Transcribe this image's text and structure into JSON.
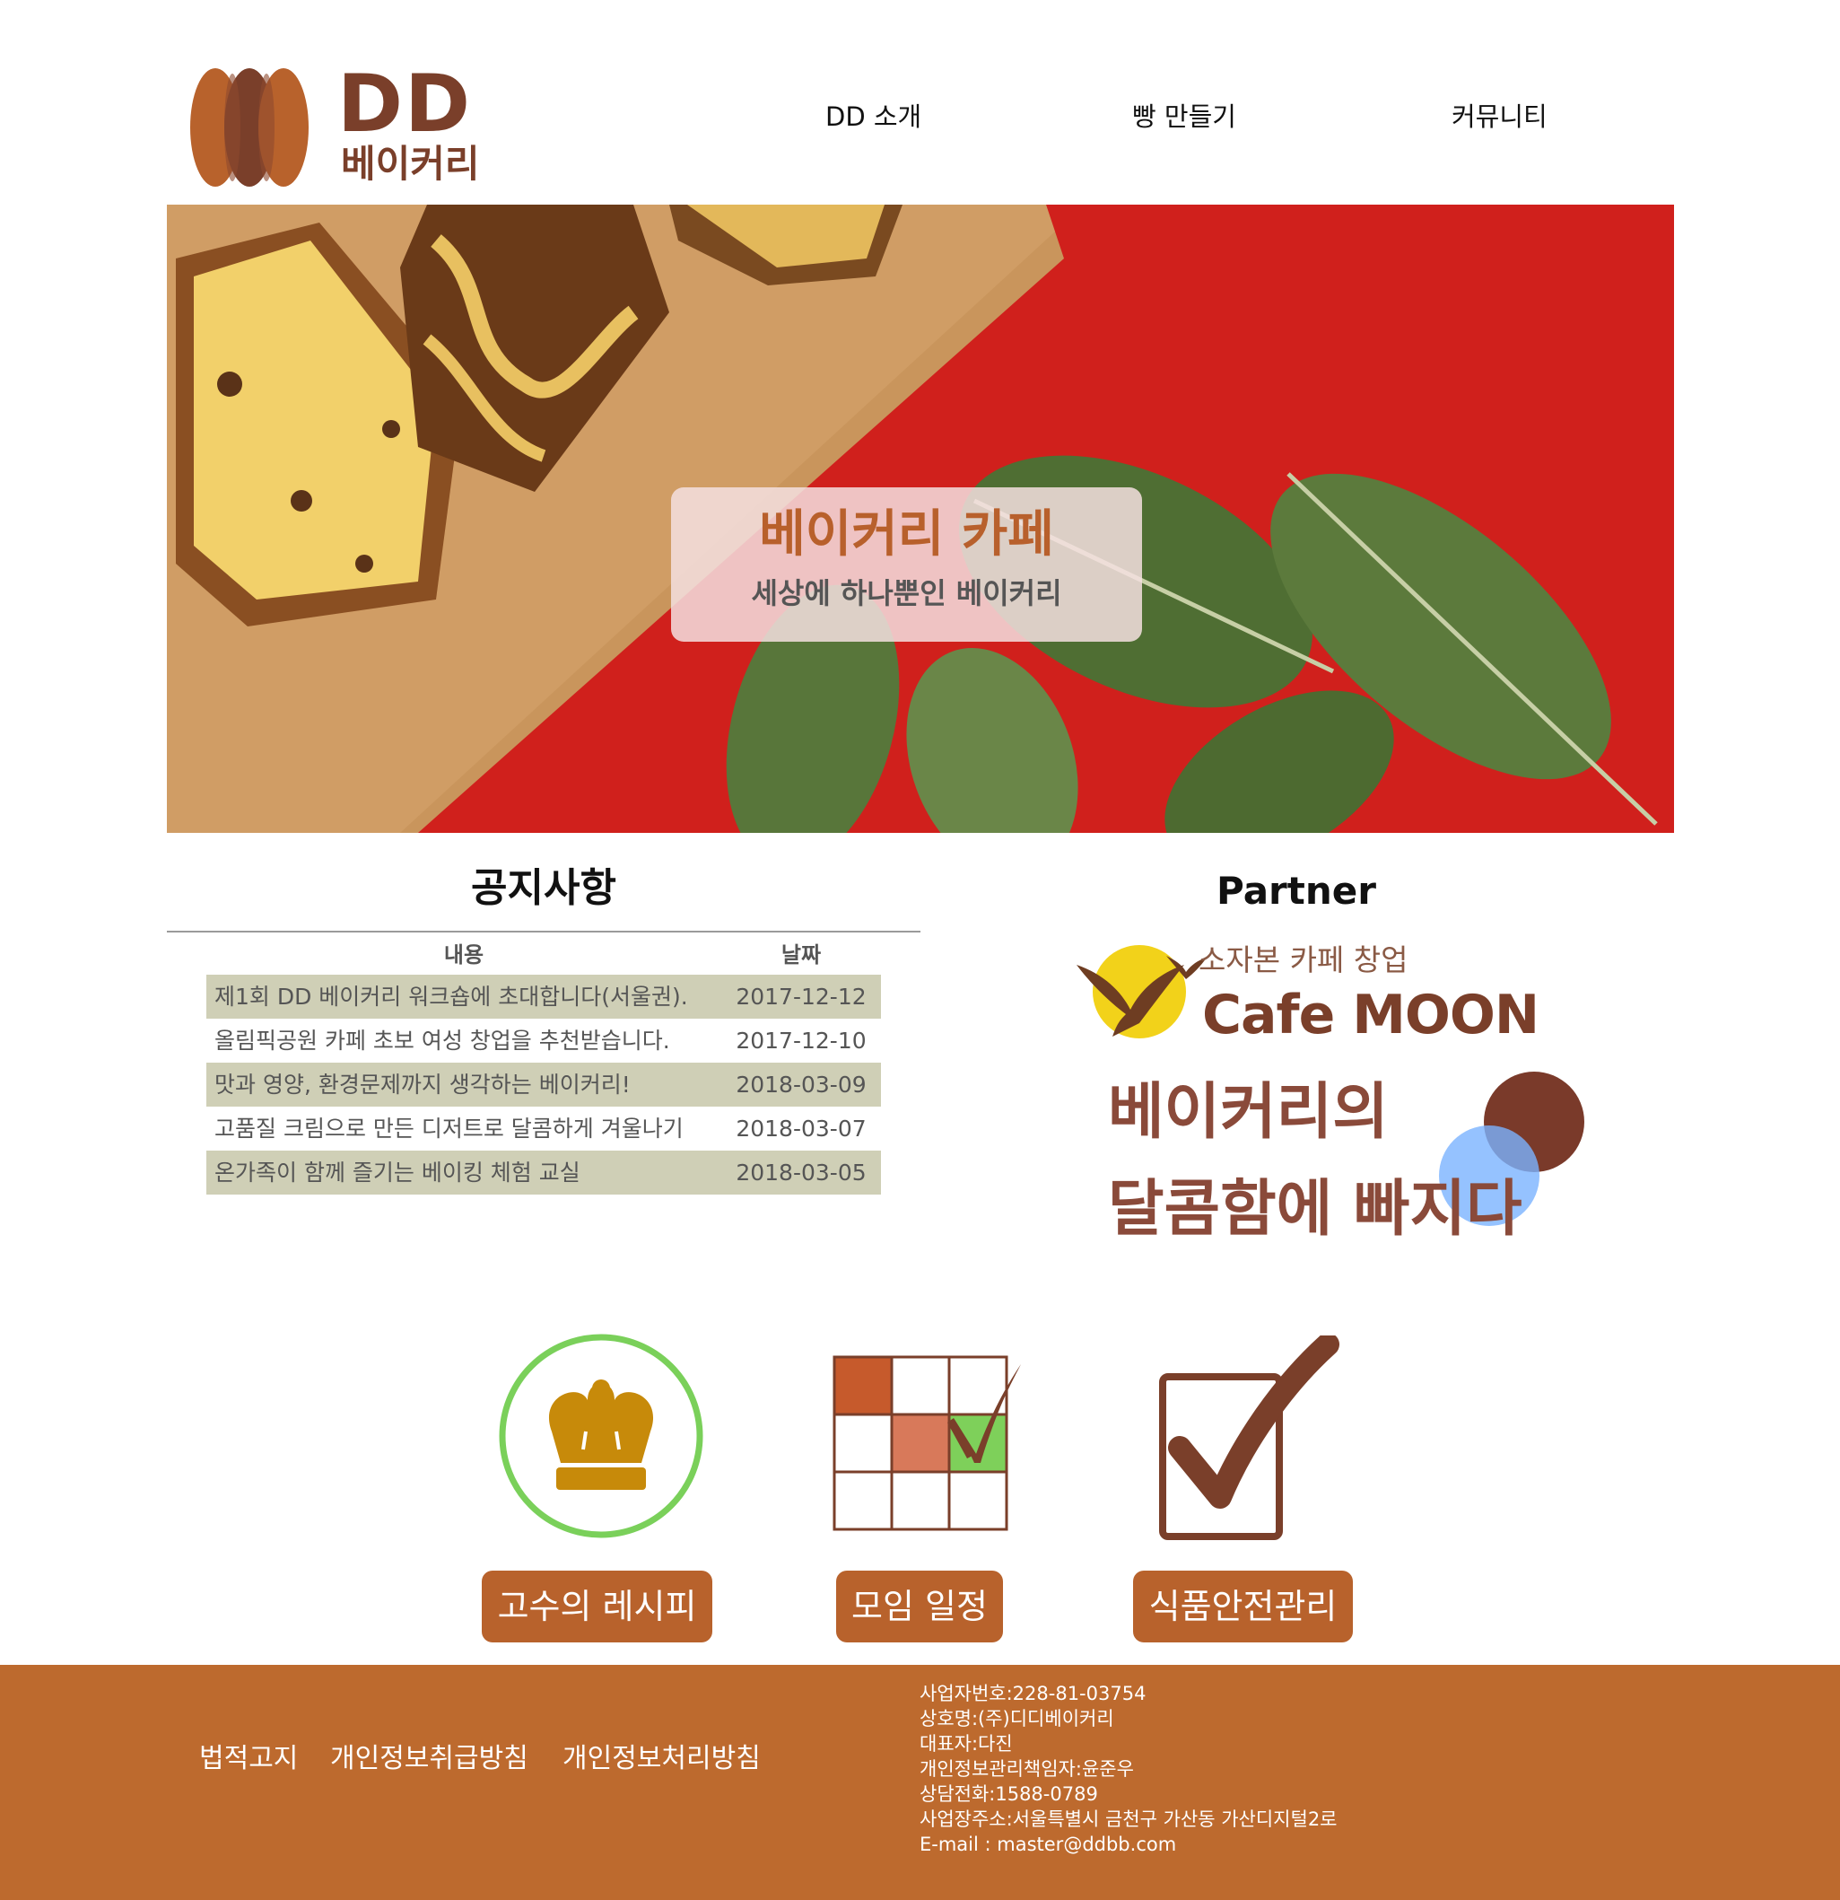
{
  "header": {
    "logo": {
      "title": "DD",
      "subtitle": "베이커리"
    },
    "nav": [
      {
        "label": "DD 소개"
      },
      {
        "label": "빵 만들기"
      },
      {
        "label": "커뮤니티"
      }
    ]
  },
  "hero": {
    "title": "베이커리 카페",
    "subtitle": "세상에 하나뿐인 베이커리"
  },
  "notice": {
    "title": "공지사항",
    "columns": [
      "내용",
      "날짜"
    ],
    "rows": [
      {
        "content": "제1회 DD 베이커리 워크숍에 초대합니다(서울권).",
        "date": "2017-12-12"
      },
      {
        "content": "올림픽공원 카페 초보 여성 창업을 추천받습니다.",
        "date": "2017-12-10"
      },
      {
        "content": "맛과 영양, 환경문제까지 생각하는 베이커리!",
        "date": "2018-03-09"
      },
      {
        "content": "고품질 크림으로 만든 디저트로 달콤하게 겨울나기",
        "date": "2018-03-07"
      },
      {
        "content": "온가족이 함께 즐기는 베이킹 체험 교실",
        "date": "2018-03-05"
      }
    ]
  },
  "partner": {
    "title": "Partner",
    "tagline": "소자본 카페 창업",
    "name": "Cafe MOON",
    "promo_line1": "베이커리의",
    "promo_line2": "달콤함에 빠지다"
  },
  "features": [
    {
      "icon": "chef-hat-icon",
      "label": "고수의 레시피"
    },
    {
      "icon": "calendar-check-icon",
      "label": "모임 일정"
    },
    {
      "icon": "checkbox-check-icon",
      "label": "식품안전관리"
    }
  ],
  "footer": {
    "links": [
      "법적고지",
      "개인정보취급방침",
      "개인정보처리방침"
    ],
    "info": [
      "사업자번호:228-81-03754",
      "상호명:(주)디디베이커리",
      "대표자:다진",
      "개인정보관리책임자:윤준우",
      "상담전화:1588-0789",
      "사업장주소:서울특별시 금천구 가산동 가산디지털2로",
      "E-mail : master@ddbb.com"
    ]
  },
  "colors": {
    "brand_brown": "#7a3f2a",
    "accent_orange": "#bd6a2e",
    "table_shade": "#cfcfb6"
  }
}
